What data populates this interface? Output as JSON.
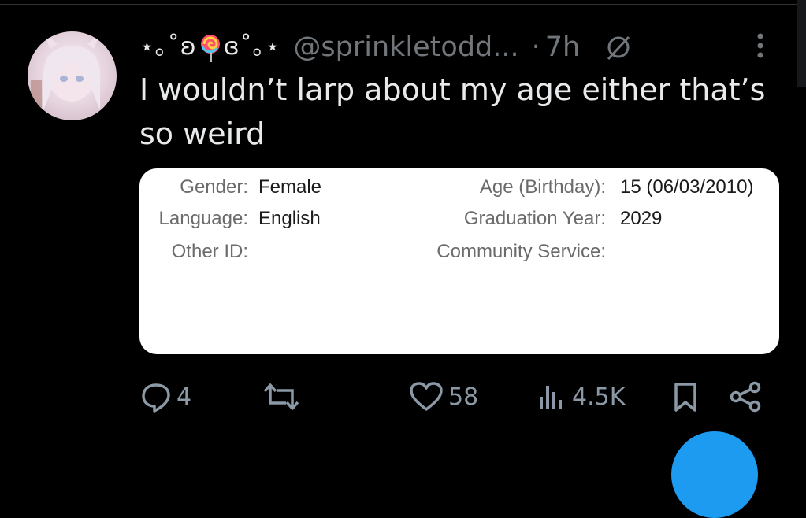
{
  "tweet": {
    "author": {
      "display_name_left": "⋆｡˚ʚ",
      "display_name_right": "ɞ˚｡⋆",
      "handle": "@sprinkletodd...",
      "dot": "·",
      "time": "7h"
    },
    "text_line1": "I wouldn’t larp about my age either that’s",
    "text_line2": "so weird",
    "card": {
      "gender_label": "Gender:",
      "gender_value": "Female",
      "language_label": "Language:",
      "language_value": "English",
      "other_id_label": "Other ID:",
      "age_label": "Age (Birthday):",
      "age_value": "15 (06/03/2010)",
      "grad_label": "Graduation Year:",
      "grad_value": "2029",
      "community_label": "Community Service:"
    },
    "actions": {
      "replies": "4",
      "likes": "58",
      "views": "4.5K"
    }
  },
  "colors": {
    "background": "#000000",
    "text": "#e7e9ea",
    "muted": "#71767b",
    "accent": "#1d9bf0"
  },
  "icons": [
    "lollipop-icon",
    "grok-icon",
    "more-icon",
    "reply-icon",
    "retweet-icon",
    "like-icon",
    "views-icon",
    "bookmark-icon",
    "share-icon"
  ]
}
